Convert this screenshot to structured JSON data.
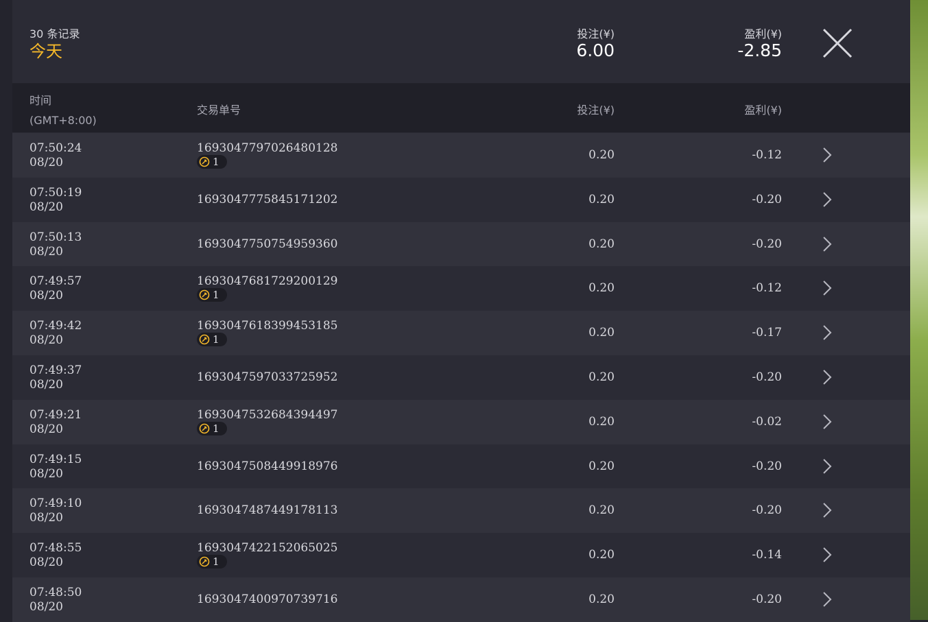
{
  "summary": {
    "record_count": "30 条记录",
    "period": "今天",
    "bet_label": "投注(¥)",
    "bet_total": "6.00",
    "profit_label": "盈利(¥)",
    "profit_total": "-2.85"
  },
  "columns": {
    "time_label": "时间",
    "time_zone": "(GMT+8:00)",
    "txid_label": "交易单号",
    "bet_label": "投注(¥)",
    "profit_label": "盈利(¥)"
  },
  "icons": {
    "close": "close-icon",
    "chevron": "chevron-right-icon",
    "badge": "free-spin-icon"
  },
  "colors": {
    "accent": "#f5b82a"
  },
  "rows": [
    {
      "time": "07:50:24",
      "date": "08/20",
      "txid": "1693047797026480128",
      "badge": "1",
      "bet": "0.20",
      "profit": "-0.12"
    },
    {
      "time": "07:50:19",
      "date": "08/20",
      "txid": "1693047775845171202",
      "badge": null,
      "bet": "0.20",
      "profit": "-0.20"
    },
    {
      "time": "07:50:13",
      "date": "08/20",
      "txid": "1693047750754959360",
      "badge": null,
      "bet": "0.20",
      "profit": "-0.20"
    },
    {
      "time": "07:49:57",
      "date": "08/20",
      "txid": "1693047681729200129",
      "badge": "1",
      "bet": "0.20",
      "profit": "-0.12"
    },
    {
      "time": "07:49:42",
      "date": "08/20",
      "txid": "1693047618399453185",
      "badge": "1",
      "bet": "0.20",
      "profit": "-0.17"
    },
    {
      "time": "07:49:37",
      "date": "08/20",
      "txid": "1693047597033725952",
      "badge": null,
      "bet": "0.20",
      "profit": "-0.20"
    },
    {
      "time": "07:49:21",
      "date": "08/20",
      "txid": "1693047532684394497",
      "badge": "1",
      "bet": "0.20",
      "profit": "-0.02"
    },
    {
      "time": "07:49:15",
      "date": "08/20",
      "txid": "1693047508449918976",
      "badge": null,
      "bet": "0.20",
      "profit": "-0.20"
    },
    {
      "time": "07:49:10",
      "date": "08/20",
      "txid": "1693047487449178113",
      "badge": null,
      "bet": "0.20",
      "profit": "-0.20"
    },
    {
      "time": "07:48:55",
      "date": "08/20",
      "txid": "1693047422152065025",
      "badge": "1",
      "bet": "0.20",
      "profit": "-0.14"
    },
    {
      "time": "07:48:50",
      "date": "08/20",
      "txid": "1693047400970739716",
      "badge": null,
      "bet": "0.20",
      "profit": "-0.20"
    }
  ]
}
